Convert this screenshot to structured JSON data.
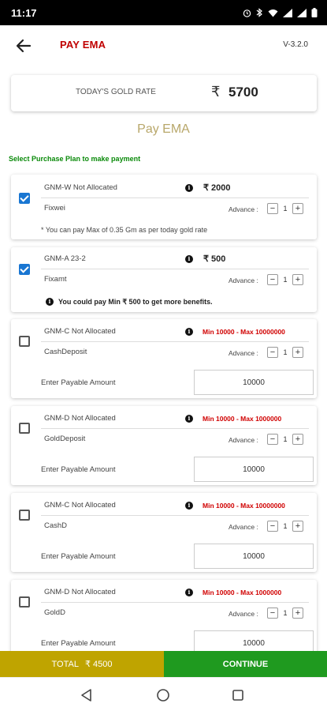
{
  "status_bar": {
    "time": "11:17"
  },
  "header": {
    "title": "PAY EMA",
    "version": "V-3.2.0"
  },
  "gold_rate": {
    "label": "TODAY'S GOLD RATE",
    "currency": "₹",
    "value": "5700"
  },
  "page_heading": "Pay EMA",
  "select_label": "Select Purchase Plan to make payment",
  "plans": [
    {
      "name": "GNM-W Not Allocated",
      "amount": "₹ 2000",
      "type": "Fixwei",
      "advance_label": "Advance :",
      "quantity": "1",
      "note": "* You can pay Max of 0.35 Gm as per today gold rate",
      "checked": true
    },
    {
      "name": "GNM-A 23-2",
      "amount": "₹ 500",
      "type": "Fixamt",
      "advance_label": "Advance :",
      "quantity": "1",
      "note": "You could pay Min ₹ 500 to get more benefits.",
      "checked": true
    },
    {
      "name": "GNM-C Not Allocated",
      "range": "Min 10000 - Max 10000000",
      "type": "CashDeposit",
      "advance_label": "Advance :",
      "quantity": "1",
      "enter_label": "Enter Payable Amount",
      "input_value": "10000",
      "checked": false
    },
    {
      "name": "GNM-D Not Allocated",
      "range": "Min 10000 - Max 1000000",
      "type": "GoldDeposit",
      "advance_label": "Advance :",
      "quantity": "1",
      "enter_label": "Enter Payable Amount",
      "input_value": "10000",
      "checked": false
    },
    {
      "name": "GNM-C Not Allocated",
      "range": "Min 10000 - Max 10000000",
      "type": "CashD",
      "advance_label": "Advance :",
      "quantity": "1",
      "enter_label": "Enter Payable Amount",
      "input_value": "10000",
      "checked": false
    },
    {
      "name": "GNM-D Not Allocated",
      "range": "Min 10000 - Max 1000000",
      "type": "GoldD",
      "advance_label": "Advance :",
      "quantity": "1",
      "enter_label": "Enter Payable Amount",
      "input_value": "10000",
      "checked": false
    }
  ],
  "stepper": {
    "minus": "−",
    "plus": "+"
  },
  "footer": {
    "total_label": "TOTAL",
    "total_value": "₹ 4500",
    "continue_label": "CONTINUE"
  },
  "colors": {
    "brand_red": "#c00000",
    "gold": "#bfa400",
    "green": "#1f9a1f",
    "checkbox_blue": "#1976d2"
  },
  "icons": [
    "back-arrow-icon",
    "info-icon",
    "nav-back-icon",
    "nav-home-icon",
    "nav-recents-icon"
  ]
}
